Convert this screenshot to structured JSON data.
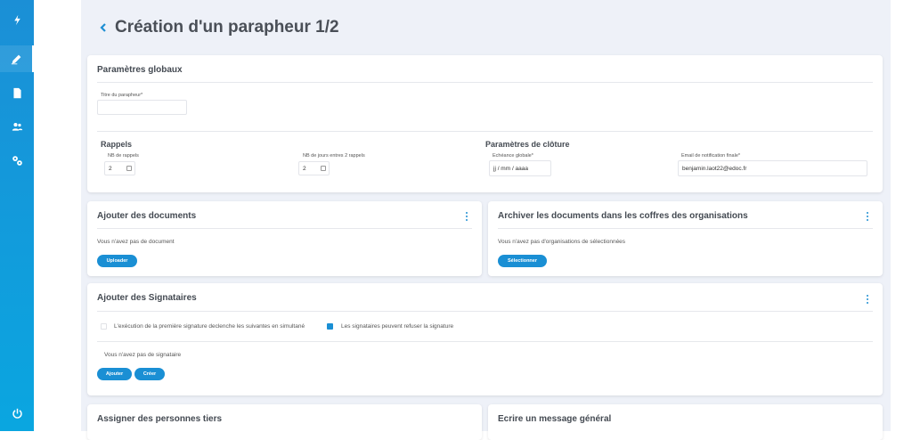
{
  "page": {
    "title": "Création d'un parapheur 1/2"
  },
  "sidebar": {
    "items": [
      "logo-icon",
      "pen-icon",
      "document-icon",
      "users-icon",
      "settings-icon",
      "power-icon"
    ]
  },
  "global_params": {
    "title": "Paramètres globaux",
    "parapheur_title_label": "Titre du parapheur*",
    "parapheur_title_value": "",
    "reminders_title": "Rappels",
    "nb_reminders_label": "NB de rappels",
    "nb_reminders_value": "2",
    "days_between_label": "NB de jours entres 2 rappels",
    "days_between_value": "2",
    "closing_title": "Paramètres de clôture",
    "deadline_label": "Echéance globale*",
    "deadline_placeholder": "jj / mm / aaaa",
    "email_label": "Email de notification finale*",
    "email_value": "benjamin.laot22@edoc.fr"
  },
  "documents": {
    "title": "Ajouter des documents",
    "empty_text": "Vous n'avez pas de document",
    "upload_label": "Uploader"
  },
  "archive": {
    "title": "Archiver les documents dans les coffres des organisations",
    "empty_text": "Vous n'avez pas d'organisations de sélectionnées",
    "select_label": "Sélectionner"
  },
  "signers": {
    "title": "Ajouter des Signataires",
    "option1_label": "L'exécution de la première signature declenche les suivantes en simultané",
    "option1_checked": false,
    "option2_label": "Les signataires peuvent refuser la signature",
    "option2_checked": true,
    "empty_text": "Vous n'avez pas de signataire",
    "add_label": "Ajouter",
    "create_label": "Créer"
  },
  "third_parties": {
    "title": "Assigner des personnes tiers"
  },
  "message": {
    "title": "Ecrire un message général"
  }
}
